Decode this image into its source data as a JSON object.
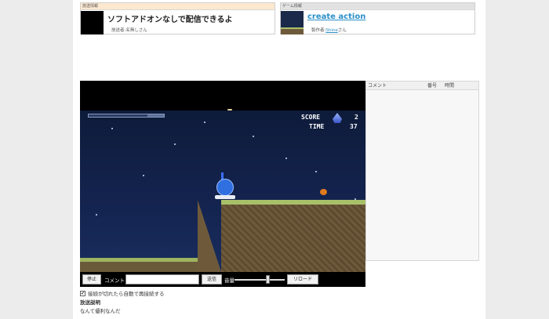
{
  "broadcast_card": {
    "header": "放送情報",
    "title": "ソフトアドオンなしで配信できるよ",
    "broadcaster_label": "放送者:",
    "broadcaster": "名無しさん"
  },
  "game_card": {
    "header": "ゲーム情報",
    "title": "create action",
    "creator_label": "製作者:",
    "creator": "Shine",
    "creator_suffix": "さん"
  },
  "game": {
    "score_label": "SCORE",
    "score": "2",
    "time_label": "TIME",
    "time": "37",
    "hp_fraction": 0.78
  },
  "controls": {
    "stop_label": "停止",
    "comment_label": "コメント",
    "comment_value": "",
    "send_label": "送信",
    "volume_label": "音量",
    "volume_fraction": 0.65,
    "reload_label": "リロード"
  },
  "comments_panel": {
    "col_comment": "コメント",
    "col_number": "番号",
    "col_time": "時間"
  },
  "options": {
    "auto_reconnect_label": "接続が切れたら自動で再接続する",
    "auto_reconnect_checked": true
  },
  "description": {
    "title": "放送説明",
    "text": "なんて優利なんだ"
  }
}
